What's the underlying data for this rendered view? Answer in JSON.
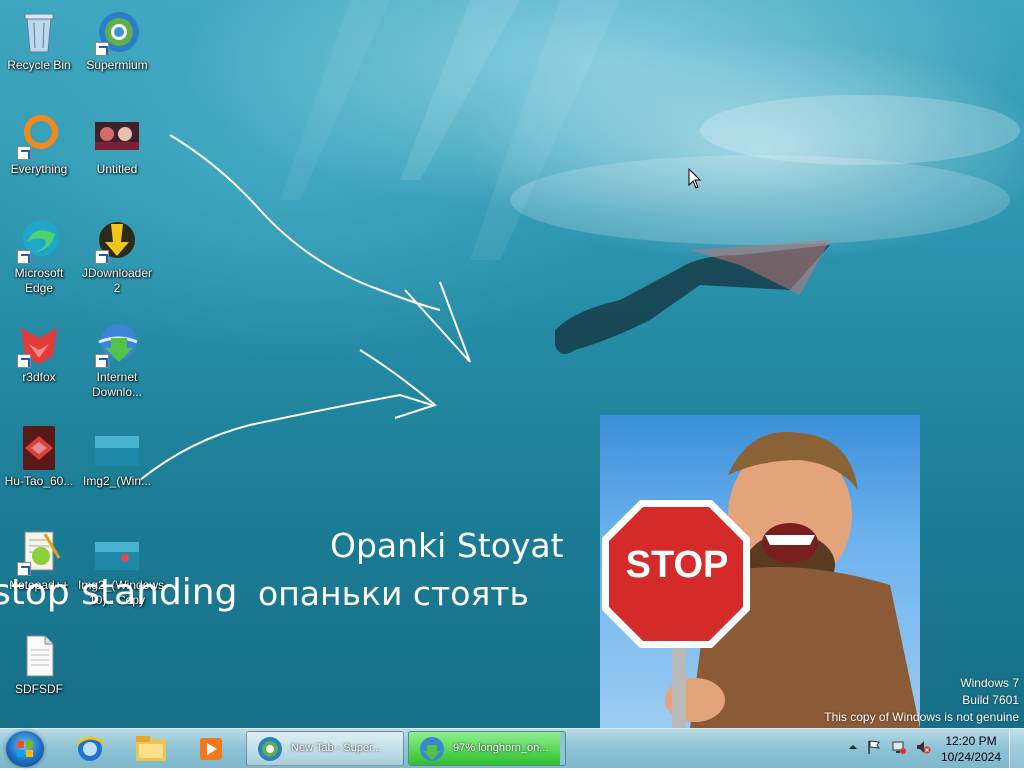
{
  "desktop": {
    "icons": [
      {
        "name": "recycle-bin",
        "label": "Recycle Bin",
        "icon": "recycle-bin-icon"
      },
      {
        "name": "supermium",
        "label": "Supermium",
        "icon": "supermium-icon"
      },
      {
        "name": "everything",
        "label": "Everything",
        "icon": "everything-icon"
      },
      {
        "name": "untitled",
        "label": "Untitled",
        "icon": "image-thumbnail-icon"
      },
      {
        "name": "microsoft-edge",
        "label": "Microsoft Edge",
        "icon": "edge-icon"
      },
      {
        "name": "jdownloader",
        "label": "JDownloader 2",
        "icon": "jdownloader-icon"
      },
      {
        "name": "r3dfox",
        "label": "r3dfox",
        "icon": "r3dfox-icon"
      },
      {
        "name": "internet-download",
        "label": "Internet Downlo...",
        "icon": "idm-icon"
      },
      {
        "name": "hu-tao",
        "label": "Hu-Tao_60...",
        "icon": "hu-tao-icon"
      },
      {
        "name": "img2",
        "label": "Img2_(Win...",
        "icon": "image-thumbnail-icon"
      },
      {
        "name": "notepad-plus",
        "label": "Notepad++",
        "icon": "notepad-plus-icon"
      },
      {
        "name": "img2-copy",
        "label": "Img2_(Windows 10) - Copy",
        "icon": "image-thumbnail-icon"
      },
      {
        "name": "sdfsdf",
        "label": "SDFSDF",
        "icon": "text-file-icon"
      }
    ],
    "overlay_texts": {
      "line1": "Opanki Stoyat",
      "line2": "опаньки стоять",
      "line3": "stop standing"
    },
    "stop_sign_text": "STOP",
    "watermark": {
      "line1": "Windows 7",
      "line2": "Build 7601",
      "line3": "This copy of Windows is not genuine"
    }
  },
  "taskbar": {
    "start_icon": "windows-start-orb-icon",
    "pinned": [
      {
        "name": "internet-explorer",
        "icon": "ie-icon"
      },
      {
        "name": "file-explorer",
        "icon": "folder-icon"
      },
      {
        "name": "media-player",
        "icon": "media-player-icon"
      }
    ],
    "windows": [
      {
        "label": "New Tab - Super...",
        "icon": "supermium-icon",
        "state": "active"
      },
      {
        "label": "97% longhorn_on...",
        "icon": "idm-icon",
        "state": "progress",
        "progress": 0.97
      }
    ],
    "tray_icons": [
      "show-hidden-icons-chevron",
      "action-center-flag-icon",
      "network-icon",
      "volume-muted-icon"
    ],
    "clock": {
      "time": "12:20 PM",
      "date": "10/24/2024"
    }
  },
  "colors": {
    "desktop_water": "#2b93ad",
    "taskbar": "#8fc4d6",
    "progress_green": "#3fcc3f",
    "stop_red": "#d52a2a"
  }
}
